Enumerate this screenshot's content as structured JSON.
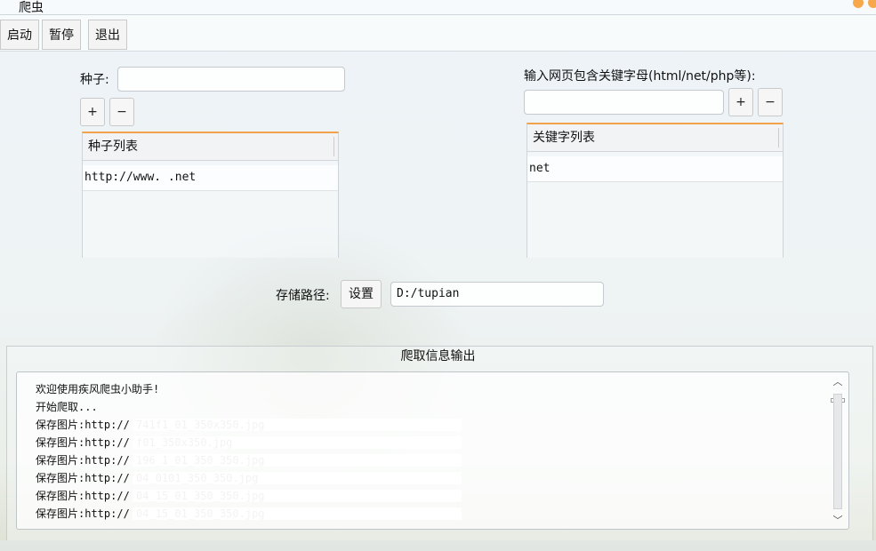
{
  "window": {
    "title": "爬虫"
  },
  "toolbar": {
    "start": "启动",
    "pause": "暂停",
    "exit": "退出"
  },
  "seed": {
    "label": "种子:",
    "value": "",
    "add": "+",
    "remove": "−",
    "list_header": "种子列表",
    "items": [
      "http://www.        .net"
    ]
  },
  "keyword": {
    "label": "输入网页包含关键字母(html/net/php等):",
    "value": "",
    "add": "+",
    "remove": "−",
    "list_header": "关键字列表",
    "items": [
      "net"
    ]
  },
  "storage": {
    "label": "存储路径:",
    "button": "设置",
    "path": "D:/tupian"
  },
  "output": {
    "title": "爬取信息输出",
    "lines": [
      "欢迎使用疾风爬虫小助手!",
      "开始爬取...",
      "保存图片:http://                                    741f1_01_350x350.jpg",
      "保存图片:http://                                    f01_350x350.jpg",
      "保存图片:http://                                    196_1_01_350_350.jpg",
      "保存图片:http://                                    04_0101_350_350.jpg",
      "保存图片:http://                                    04_15_01_350_350.jpg",
      "保存图片:http://                                    04_15_01_350_350.jpg"
    ]
  },
  "colors": {
    "accent": "#f2a24b",
    "window_dot": "#f6a84a"
  }
}
